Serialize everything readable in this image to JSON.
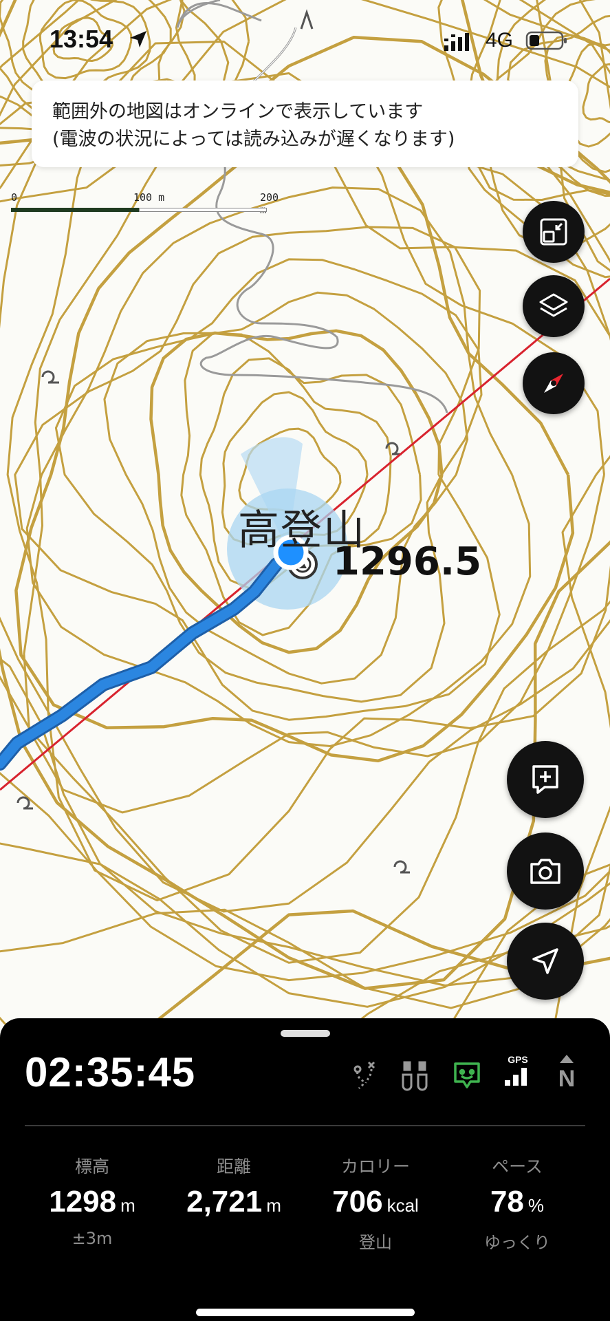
{
  "status_bar": {
    "time": "13:54",
    "network": "4G"
  },
  "notice": {
    "line1": "範囲外の地図はオンラインで表示しています",
    "line2": "(電波の状況によっては読み込みが遅くなります)"
  },
  "scale": {
    "tick0": "0",
    "tick1": "100 m",
    "tick2": "200 m"
  },
  "map": {
    "peak_name": "高登山",
    "peak_elevation": "1296.5",
    "colors": {
      "contour": "#c4a040",
      "route": "#2b86e0",
      "line": "#d8232e",
      "road": "#9a9a9a"
    }
  },
  "controls": [
    {
      "icon": "fullscreen-toggle-icon"
    },
    {
      "icon": "layers-icon"
    },
    {
      "icon": "compass-icon"
    },
    {
      "icon": "add-note-icon"
    },
    {
      "icon": "camera-icon"
    },
    {
      "icon": "locate-me-icon"
    }
  ],
  "panel": {
    "timer": "02:35:45",
    "gps_label": "GPS",
    "north_label": "N",
    "stats": [
      {
        "label": "標高",
        "value": "1298",
        "unit": "m",
        "sub": "±3m"
      },
      {
        "label": "距離",
        "value": "2,721",
        "unit": "m",
        "sub": ""
      },
      {
        "label": "カロリー",
        "value": "706",
        "unit": "kcal",
        "sub": "登山"
      },
      {
        "label": "ペース",
        "value": "78",
        "unit": "%",
        "sub": "ゆっくり"
      }
    ]
  }
}
